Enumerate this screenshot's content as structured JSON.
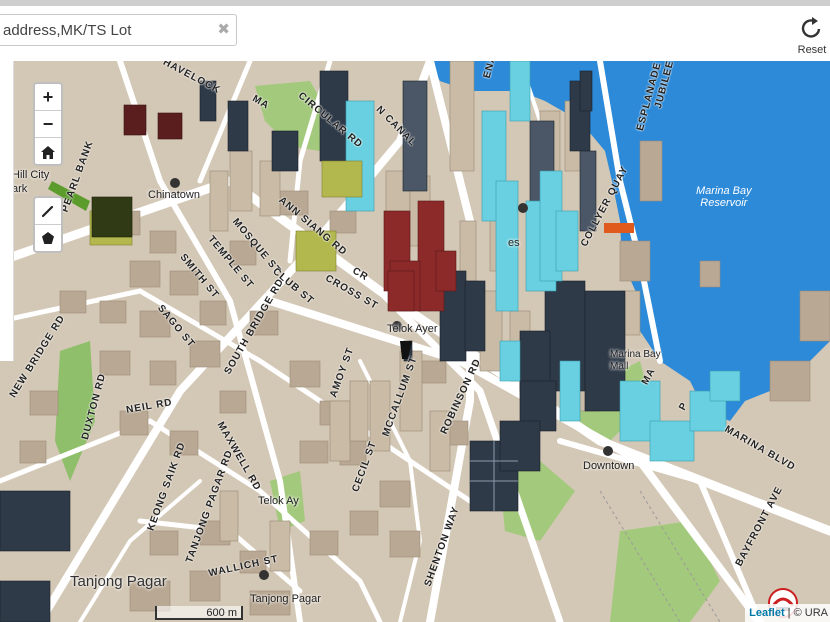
{
  "search": {
    "value": "address,MK/TS Lot",
    "clear_icon": "close-icon"
  },
  "reset": {
    "label": "Reset",
    "icon": "refresh-icon"
  },
  "zoom_controls": {
    "zoom_in": "+",
    "zoom_out": "−",
    "home_icon": "home-icon"
  },
  "draw_controls": {
    "line_icon": "pencil-icon",
    "polygon_icon": "pentagon-icon"
  },
  "scale_bar": "600 m",
  "attribution": {
    "leaflet": "Leaflet",
    "sep": " | ",
    "source": "© URA"
  },
  "labels": {
    "water": "Marina Bay\nReservoir",
    "places": {
      "hill_city": "Hill City",
      "park": "ark",
      "chinatown": "Chinatown",
      "telok_ayer_station": "Telok Ayer",
      "marina_bay_mall": "Marina Bay\nMall",
      "downtown": "Downtown",
      "telok_ayer": "Telok Ay",
      "tanjong_pagar": "Tanjong Pagar",
      "tanjong_pagar_2": "Tanjong Pagar",
      "es": "es"
    },
    "roads": {
      "havelock": "HAVELOCK",
      "new_bridge": "NEW BRIDGE RD",
      "cross_st": "CROSS ST",
      "collyer_quay": "COLLYER QUAY",
      "esplanade": "ESPLANADE",
      "jubilee": "JUBILEE",
      "robinson": "ROBINSON RD",
      "shenton": "SHENTON WAY",
      "marina_blvd": "MARINA BLVD",
      "bayfront": "BAYFRONT AVE",
      "maxwell": "MAXWELL RD",
      "neil": "NEIL RD",
      "wallich": "WALLICH ST",
      "mosque": "MOSQUE ST",
      "temple": "TEMPLE ST",
      "smith": "SMITH ST",
      "sago": "SAGO ST",
      "south_bridge": "SOUTH BRIDGE RD",
      "n_canal": "N CANAL",
      "keong_saik": "KEONG SAIK RD",
      "tanjong_pagar_rd": "TANJONG PAGAR RD",
      "amoy": "AMOY ST",
      "mccallum": "MCCALLUM ST",
      "cecil": "CECIL ST",
      "club": "CLUB ST",
      "ann_siang": "ANN SIANG RD",
      "circular": "CIRCULAR RD",
      "duxton": "DUXTON RD",
      "pearl": "PEARL BANK",
      "ma": "MA",
      "enda": "ENA",
      "pa": "P",
      "cr": "CR",
      "ma2": "MA"
    }
  },
  "colors": {
    "water": "#2c8ad8",
    "land": "#d3c7b5",
    "park": "#a3c97c",
    "building": "#b9a893",
    "tower_dark": "#2f3a48",
    "tower_cyan": "#68d0e0",
    "tower_red": "#8c2a2a",
    "tower_orange": "#e05a1e"
  }
}
